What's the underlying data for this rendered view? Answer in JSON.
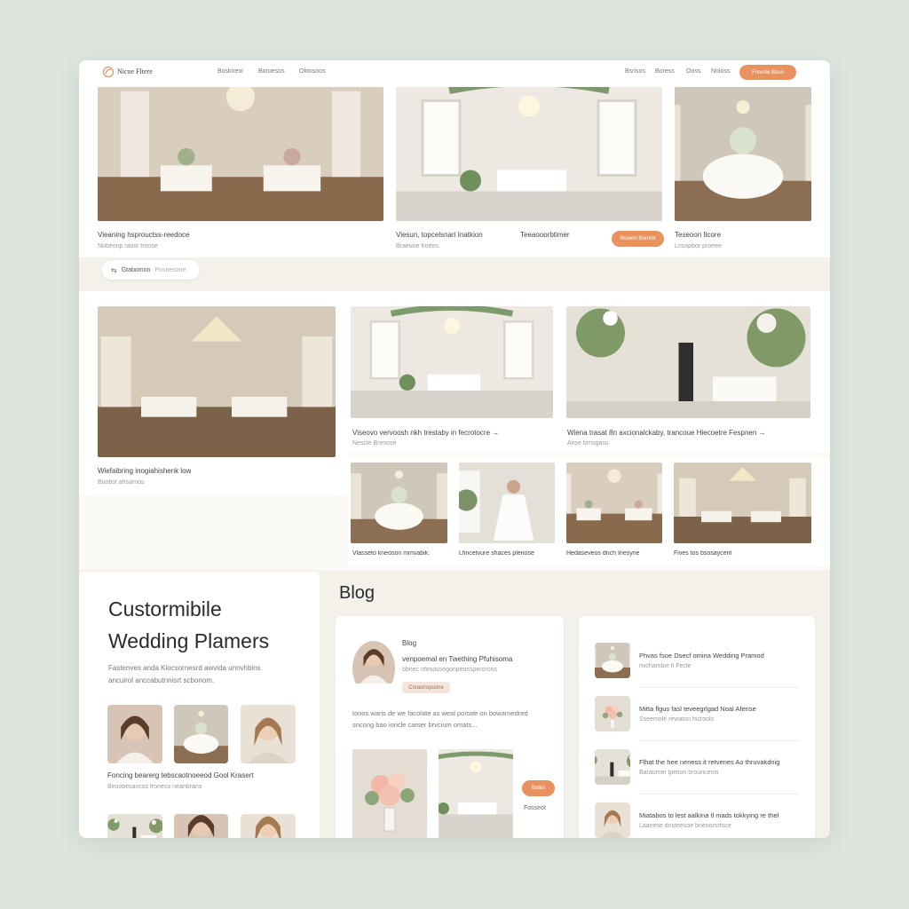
{
  "header": {
    "logo_text": "Nicoe Fltere",
    "nav_left": [
      "Boskneoi",
      "Boroesos",
      "Oktosoos"
    ],
    "nav_right": [
      "Bsrisos",
      "Boress",
      "Ooss",
      "Noloss"
    ],
    "cta_label": "Fnreste Bsuo"
  },
  "featured": [
    {
      "caption": "Vieaning hsprouctss-reedoce",
      "sub": "Nobeonp raosr trnose"
    },
    {
      "caption": "Viesun, topcelsnari Inatkion",
      "sub": "Braeune froeos"
    },
    {
      "caption": "Teeaooorbtimer",
      "sub": ""
    },
    {
      "caption": "Teseoon Ilcore",
      "sub": "Lnsopbor proeee"
    }
  ],
  "featured_button": "Nsreon Borone",
  "filter_chip": {
    "label": "Gtabomon",
    "sub": "Posnesone"
  },
  "gallery": {
    "large": {
      "caption": "Wiefaibring inogiahishenk low",
      "sub": "Buobst ahsarnos"
    },
    "wide": [
      {
        "caption": "Viseovo vervoosh nkh trestaby in fecrotocre →",
        "sub": "Nescle Brenose"
      },
      {
        "caption": "Wiena trasat 8n axcionalckaby, trancoue Hiecoetre Fespnen →",
        "sub": "Anse brnsgasu"
      }
    ],
    "small": [
      {
        "caption": "Vlasseto kneoson mmvabik."
      },
      {
        "caption": "Lfincetvure shaces plenose"
      },
      {
        "caption": "Hedaseveos dnch Iriesyne"
      },
      {
        "caption": "Fives tos bsosaycent"
      }
    ]
  },
  "planners": {
    "title_line1": "Custormibile",
    "title_line2": "Wedding Plamers",
    "desc_line1": "Fastenves anda Kiocsornesrd awvida unnvhbins",
    "desc_line2": "ancuirol anccabutnnisrt scbonom.",
    "caption": "Foncing bearerg tebscaotnoeeod Gool Krasert",
    "sub": "Beoobesancss froneco neanbrans"
  },
  "blog": {
    "heading": "Blog",
    "post": {
      "title": "Blog",
      "author_line": "venpoemal en Twething Pfuhisoma",
      "meta": "obnec ofesossegonpeossperorons",
      "tag": "Cnrasrrepsone",
      "excerpt_line1": "tonos waris de we facolate as weal portate on bowarnedred",
      "excerpt_line2": "sncong bao ioricle carser brvcium omats...",
      "side_button": "Boles",
      "side_text": "Fosseot"
    },
    "list": [
      {
        "title": "Phvas fsoe Dsecf omina Wedding Pramod",
        "sub": "michambie fi Fecle"
      },
      {
        "title": "Mitta flgus fasl teveegrlgad Noal Afense",
        "sub": "Sseemole rewaton fscrools"
      },
      {
        "title": "Flhat the hee neness it retvenes Ao thruvakdnig",
        "sub": "Baraumer lpetion brouncenis"
      },
      {
        "title": "Miatabos to lest aalkina tl mads tokkying re thel",
        "sub": "Laanese dnsteesoe bneoorsrfoce"
      }
    ]
  },
  "colors": {
    "accent": "#e8935f",
    "page_bg": "#dde5dd",
    "panel_bg": "#f4f1ea"
  },
  "icons": [
    "flower-logo-icon",
    "filter-icon",
    "arrow-right-icon"
  ]
}
